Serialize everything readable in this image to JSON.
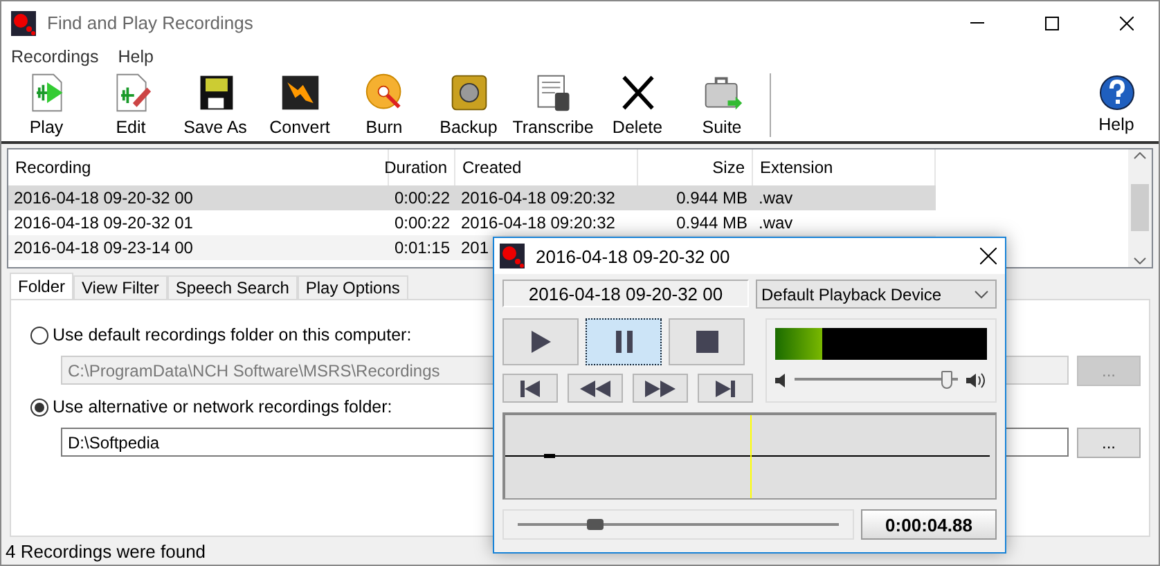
{
  "window": {
    "title": "Find and Play Recordings"
  },
  "menu": [
    "Recordings",
    "Help"
  ],
  "toolbar": [
    {
      "kind": "play",
      "label": "Play"
    },
    {
      "kind": "edit",
      "label": "Edit"
    },
    {
      "kind": "save",
      "label": "Save As"
    },
    {
      "kind": "convert",
      "label": "Convert"
    },
    {
      "kind": "burn",
      "label": "Burn"
    },
    {
      "kind": "backup",
      "label": "Backup"
    },
    {
      "kind": "transcribe",
      "label": "Transcribe"
    },
    {
      "kind": "delete",
      "label": "Delete"
    },
    {
      "kind": "suite",
      "label": "Suite"
    }
  ],
  "help_button": {
    "label": "Help"
  },
  "table": {
    "columns": [
      "Recording",
      "Duration",
      "Created",
      "Size",
      "Extension"
    ],
    "rows": [
      {
        "selected": true,
        "cells": [
          "2016-04-18 09-20-32 00",
          "0:00:22",
          "2016-04-18 09:20:32",
          "0.944 MB",
          ".wav"
        ]
      },
      {
        "selected": false,
        "cells": [
          "2016-04-18 09-20-32 01",
          "0:00:22",
          "2016-04-18 09:20:32",
          "0.944 MB",
          ".wav"
        ]
      },
      {
        "selected": false,
        "cells": [
          "2016-04-18 09-23-14 00",
          "0:01:15",
          "201"
        ]
      }
    ]
  },
  "tabs": [
    {
      "label": "Folder",
      "selected": true
    },
    {
      "label": "View Filter",
      "selected": false
    },
    {
      "label": "Speech Search",
      "selected": false
    },
    {
      "label": "Play Options",
      "selected": false
    }
  ],
  "folder_options": [
    {
      "label": "Use default recordings folder on this computer:",
      "selected": false,
      "path": "C:\\ProgramData\\NCH Software\\MSRS\\Recordings",
      "disabled": true,
      "browse": "..."
    },
    {
      "label": "Use alternative or network recordings folder:",
      "selected": true,
      "path": "D:\\Softpedia",
      "disabled": false,
      "browse": "..."
    }
  ],
  "status_bar": "4 Recordings were found",
  "player": {
    "title": "2016-04-18 09-20-32 00",
    "file": "2016-04-18 09-20-32 00",
    "device": "Default Playback Device",
    "transport": [
      {
        "kind": "play",
        "selected": false
      },
      {
        "kind": "pause",
        "selected": true
      },
      {
        "kind": "stop",
        "selected": false
      }
    ],
    "seek_buttons": [
      {
        "kind": "start"
      },
      {
        "kind": "rewind"
      },
      {
        "kind": "forward"
      },
      {
        "kind": "end"
      }
    ],
    "meter": {
      "level": 0.22
    },
    "volume": {
      "level": 0.93
    },
    "cursor": {
      "level": 0.5
    },
    "position": {
      "level": 0.24
    },
    "time": "0:00:04.88"
  }
}
